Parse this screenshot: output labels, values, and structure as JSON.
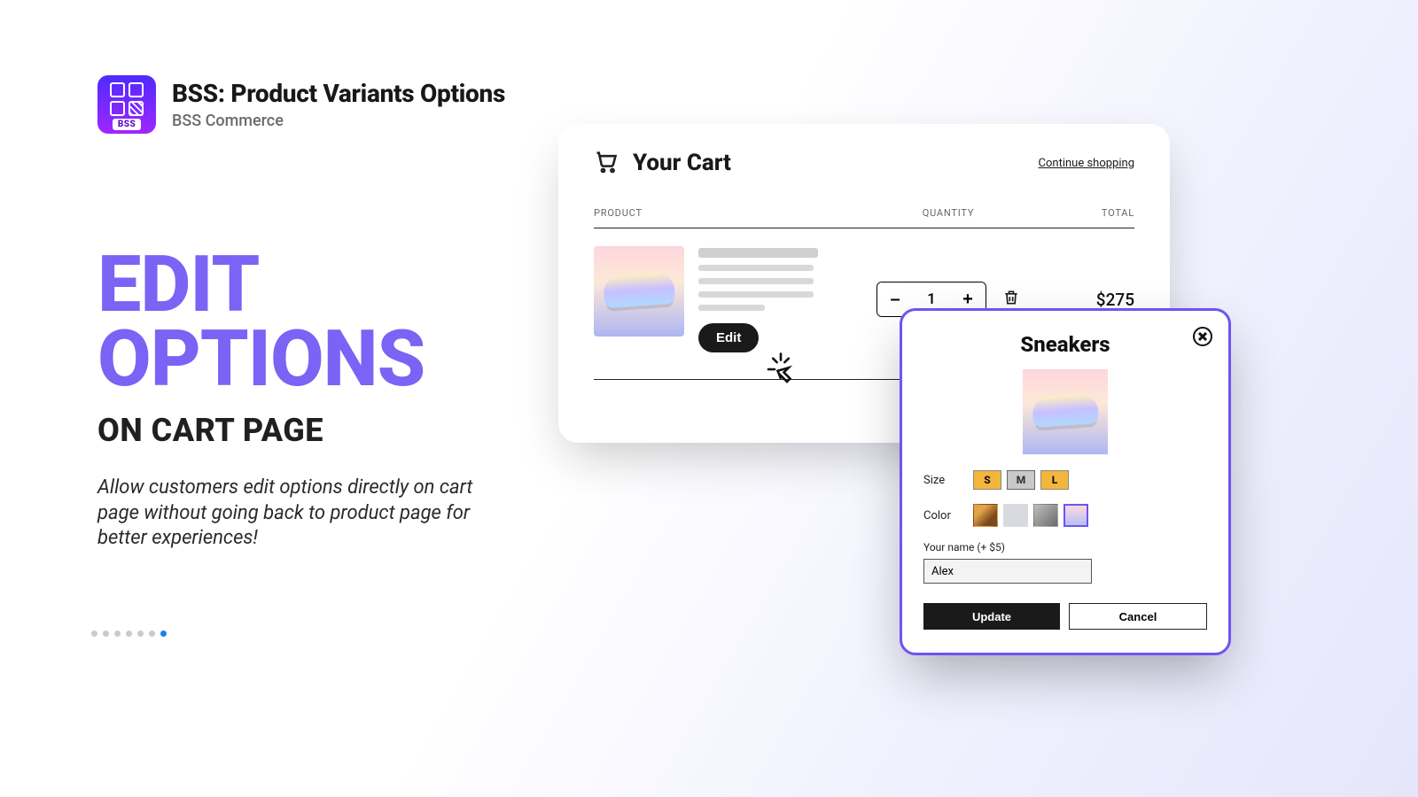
{
  "header": {
    "logo_tag": "BSS",
    "title": "BSS: Product Variants Options",
    "subtitle": "BSS Commerce"
  },
  "hero": {
    "big_line1": "EDIT",
    "big_line2": "OPTIONS",
    "subtitle": "ON CART PAGE",
    "description": "Allow customers edit options directly on cart page without going back to product page for better experiences!"
  },
  "pagination": {
    "total": 7,
    "active_index": 6
  },
  "cart": {
    "title": "Your Cart",
    "continue_label": "Continue shopping",
    "columns": {
      "product": "PRODUCT",
      "quantity": "QUANTITY",
      "total": "TOTAL"
    },
    "item": {
      "quantity": 1,
      "total": "$275",
      "edit_label": "Edit"
    },
    "qty_decrement": "–",
    "qty_increment": "+",
    "total_label": "Total"
  },
  "modal": {
    "title": "Sneakers",
    "size_label": "Size",
    "sizes": {
      "s": "S",
      "m": "M",
      "l": "L"
    },
    "color_label": "Color",
    "name_field_label": "Your name (+ $5)",
    "name_value": "Alex",
    "update_label": "Update",
    "cancel_label": "Cancel"
  }
}
